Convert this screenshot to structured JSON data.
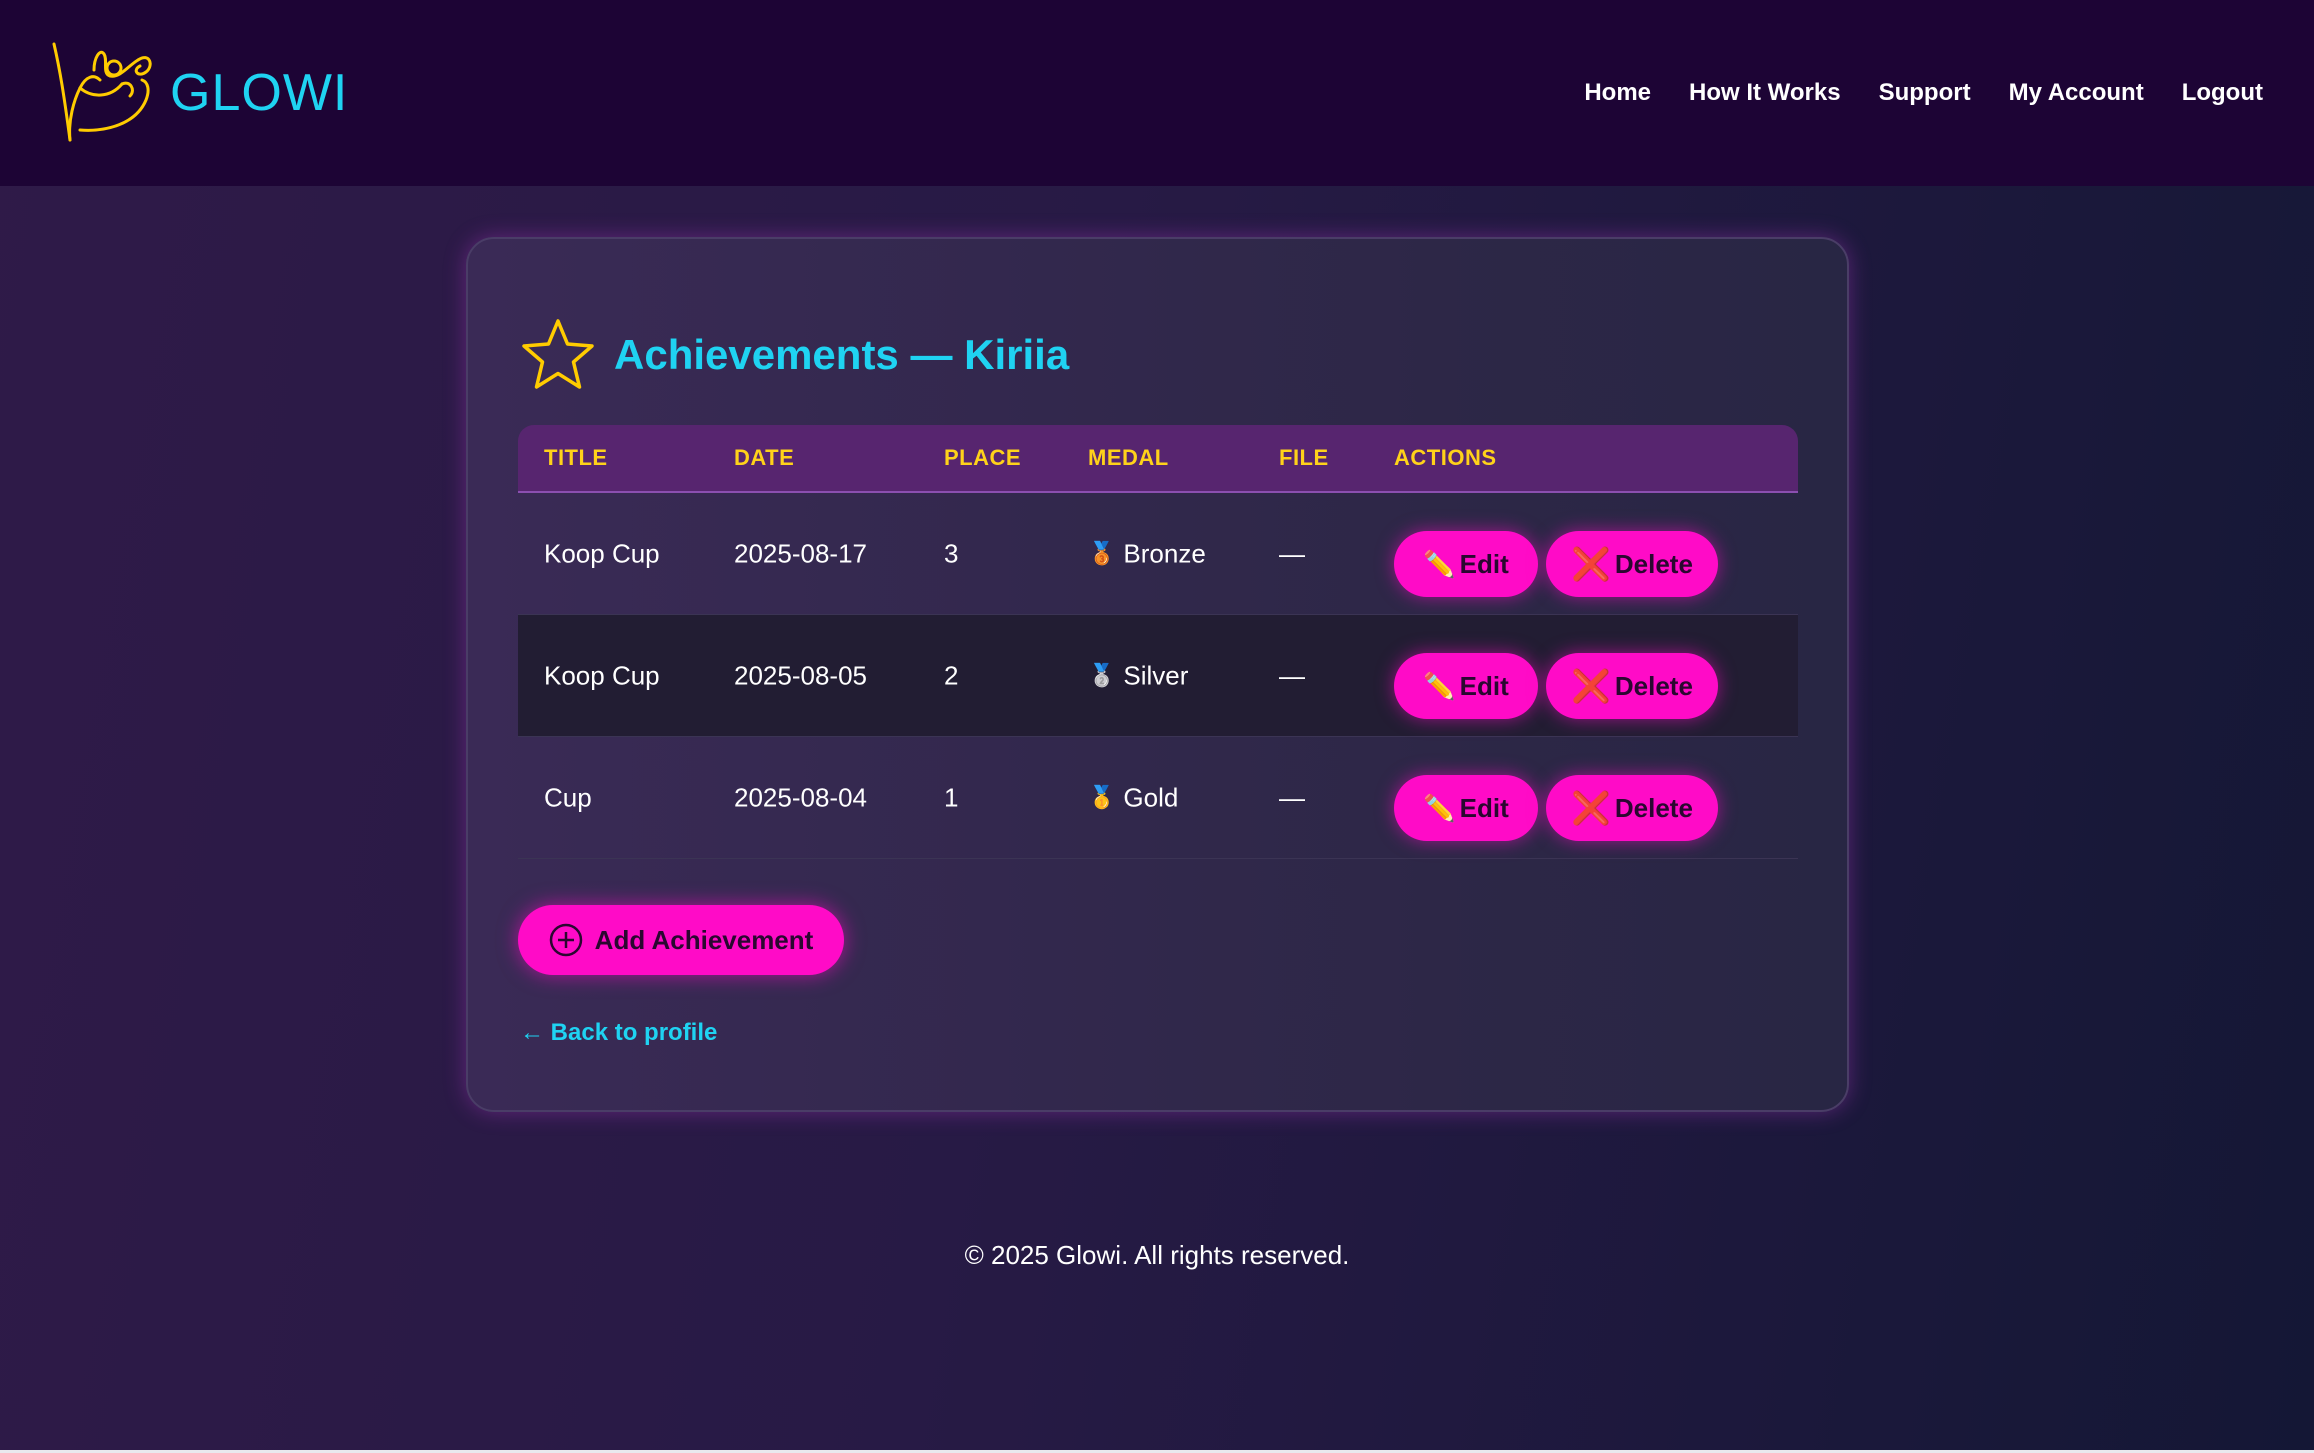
{
  "header": {
    "brand": "GLOWI",
    "logo_icon": "gymnast-ribbon-icon",
    "nav": [
      "Home",
      "How It Works",
      "Support",
      "My Account",
      "Logout"
    ]
  },
  "page": {
    "title": "Achievements — Kiriia",
    "title_icon": "star-icon"
  },
  "table": {
    "columns": [
      "TITLE",
      "DATE",
      "PLACE",
      "MEDAL",
      "FILE",
      "ACTIONS"
    ],
    "rows": [
      {
        "title": "Koop Cup",
        "date": "2025-08-17",
        "place": "3",
        "medal_icon": "🥉",
        "medal": "Bronze",
        "file": "—"
      },
      {
        "title": "Koop Cup",
        "date": "2025-08-05",
        "place": "2",
        "medal_icon": "🥈",
        "medal": "Silver",
        "file": "—"
      },
      {
        "title": "Cup",
        "date": "2025-08-04",
        "place": "1",
        "medal_icon": "🥇",
        "medal": "Gold",
        "file": "—"
      }
    ],
    "edit_label": "Edit",
    "edit_icon": "✏️",
    "delete_label": "Delete",
    "delete_icon": "❌"
  },
  "actions": {
    "add_label": "Add Achievement",
    "back_label": "← Back to profile"
  },
  "footer": {
    "text": "© 2025 Glowi. All rights reserved."
  },
  "colors": {
    "accent_cyan": "#1fd3f2",
    "accent_pink": "#ff0bc7",
    "accent_yellow": "#ffd21a",
    "header_bg": "#1d0435"
  }
}
